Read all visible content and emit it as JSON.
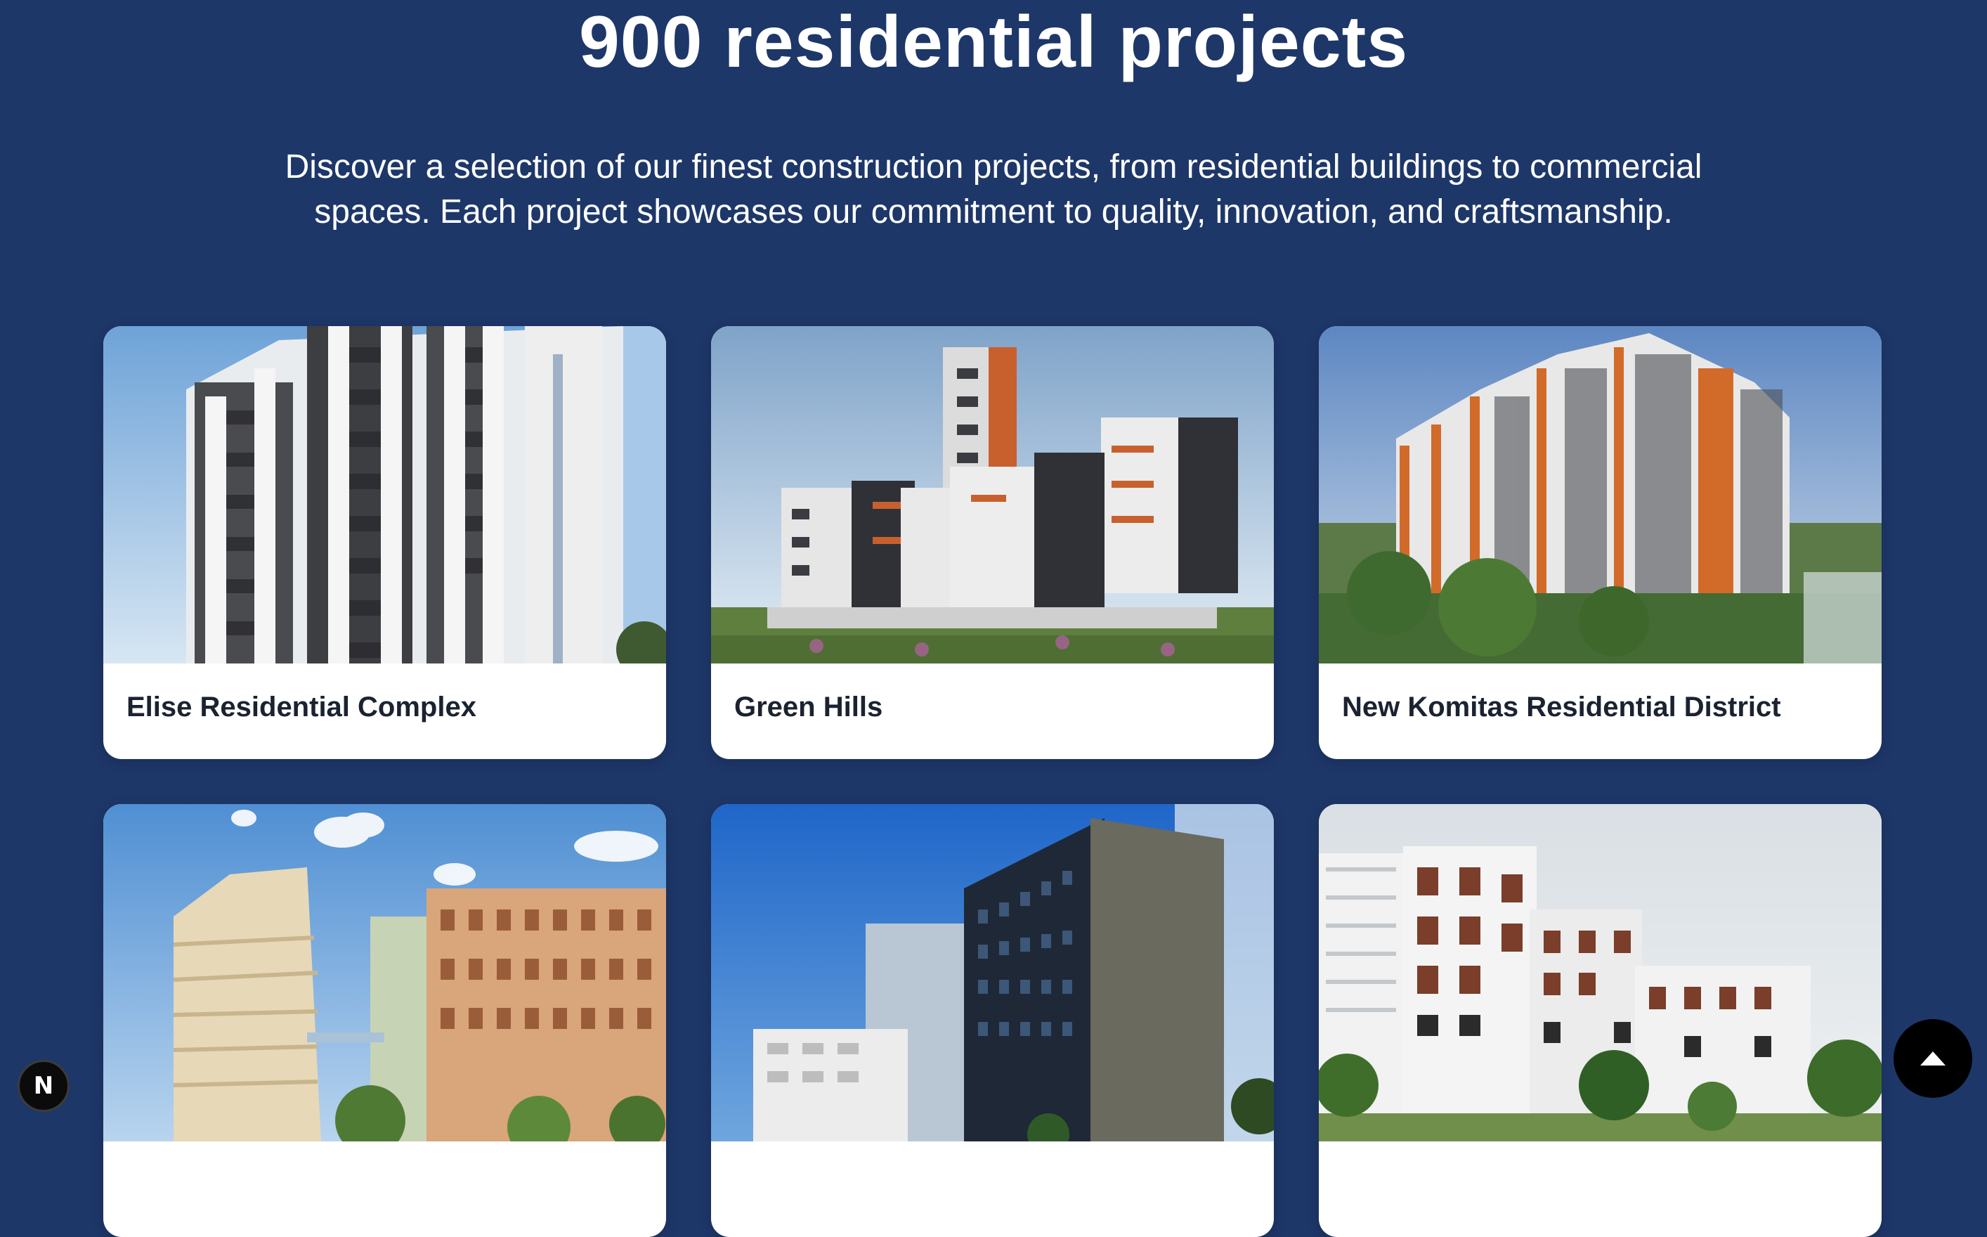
{
  "section": {
    "title": "900 residential projects",
    "description": "Discover a selection of our finest construction projects, from residential buildings to commercial spaces. Each project showcases our commitment to quality, innovation, and craftsmanship."
  },
  "projects": [
    {
      "title": "Elise Residential Complex"
    },
    {
      "title": "Green Hills"
    },
    {
      "title": "New Komitas Residential District"
    },
    {
      "title": ""
    },
    {
      "title": ""
    },
    {
      "title": ""
    }
  ],
  "floating": {
    "next_badge_letter": "N",
    "scroll_top_icon": "arrow-up-icon"
  },
  "colors": {
    "background": "#1e3769",
    "card": "#ffffff",
    "title_text": "#1b2230"
  }
}
